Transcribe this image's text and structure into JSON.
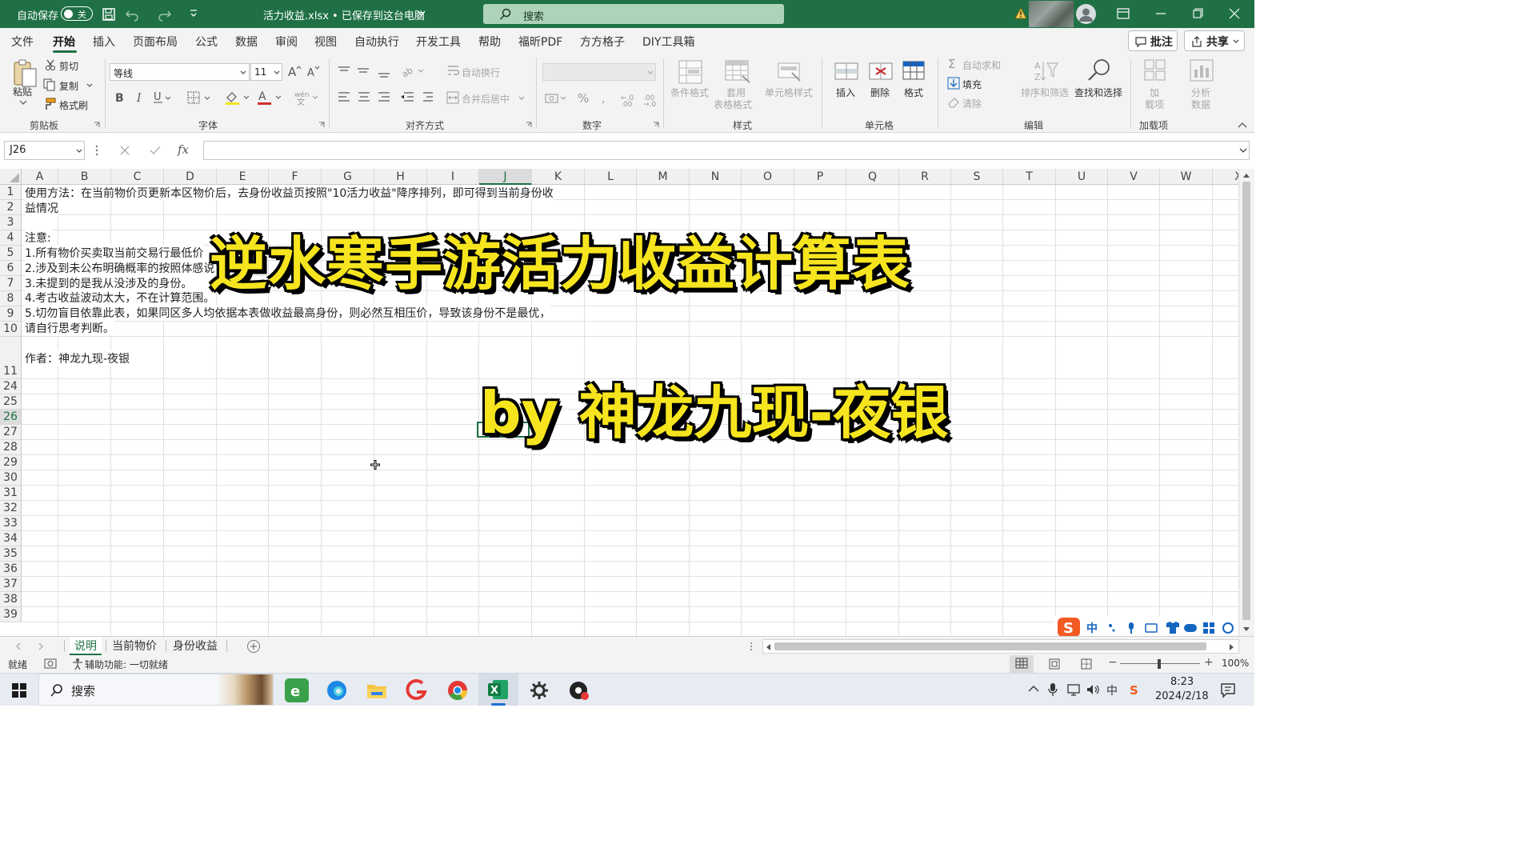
{
  "titlebar": {
    "autosave_label": "自动保存",
    "autosave_state": "关",
    "doc_title": "活力收益.xlsx • 已保存到这台电脑",
    "search_placeholder": "搜索"
  },
  "menu": {
    "tabs": [
      "文件",
      "开始",
      "插入",
      "页面布局",
      "公式",
      "数据",
      "审阅",
      "视图",
      "自动执行",
      "开发工具",
      "帮助",
      "福昕PDF",
      "方方格子",
      "DIY工具箱"
    ],
    "active_tab": "开始",
    "comment_button": "批注",
    "share_button": "共享"
  },
  "ribbon": {
    "clipboard": {
      "paste": "粘贴",
      "cut": "剪切",
      "copy": "复制",
      "format_painter": "格式刷",
      "group": "剪贴板"
    },
    "font": {
      "font_name": "等线",
      "font_size": "11",
      "group": "字体"
    },
    "alignment": {
      "wrap": "自动换行",
      "merge": "合并后居中",
      "group": "对齐方式"
    },
    "number": {
      "group": "数字"
    },
    "styles": {
      "conditional": "条件格式",
      "table_line1": "套用",
      "table_line2": "表格格式",
      "cell_styles": "单元格样式",
      "group": "样式"
    },
    "cells": {
      "insert": "插入",
      "delete": "删除",
      "format": "格式",
      "group": "单元格"
    },
    "editing": {
      "autosum": "自动求和",
      "fill": "填充",
      "clear": "清除",
      "sort": "排序和筛选",
      "find": "查找和选择",
      "group": "编辑"
    },
    "addins": {
      "addin_line1": "加",
      "addin_line2": "载项",
      "analyze_line1": "分析",
      "analyze_line2": "数据",
      "group": "加载项"
    }
  },
  "formula_bar": {
    "name_box": "J26",
    "fx": "fx",
    "content": ""
  },
  "grid": {
    "columns": [
      "A",
      "B",
      "C",
      "D",
      "E",
      "F",
      "G",
      "H",
      "I",
      "J",
      "K",
      "L",
      "M",
      "N",
      "O",
      "P",
      "Q",
      "R",
      "S",
      "T",
      "U",
      "V",
      "W",
      "X"
    ],
    "selected_column": "J",
    "rows": [
      "1",
      "2",
      "3",
      "4",
      "5",
      "6",
      "7",
      "8",
      "9",
      "10",
      "11",
      "24",
      "25",
      "26",
      "27",
      "28",
      "29",
      "30",
      "31",
      "32",
      "33",
      "34",
      "35",
      "36",
      "37",
      "38",
      "39"
    ],
    "selected_row": "26",
    "cells": {
      "a1_line1": "使用方法：在当前物价页更新本区物价后，去身份收益页按照\"10活力收益\"降序排列，即可得到当前身份收",
      "a1_line2": "益情况",
      "a4": "注意:",
      "a5": "1.所有物价买卖取当前交易行最低价",
      "a6": "2.涉及到未公布明确概率的按照体感说",
      "a7": "3.未提到的是我从没涉及的身份。",
      "a8": "4.考古收益波动太大，不在计算范围。",
      "a9_line1": "5.切勿盲目依靠此表，如果同区多人均依据本表做收益最高身份，则必然互相压价，导致该身份不是最优，",
      "a9_line2": "请自行思考判断。",
      "a10": "作者：神龙九现-夜银"
    }
  },
  "overlay": {
    "title": "逆水寒手游活力收益计算表",
    "byline": "by 神龙九现-夜银",
    "color": "#f6e51e"
  },
  "sheets": {
    "tabs": [
      "说明",
      "当前物价",
      "身份收益"
    ],
    "active": "说明"
  },
  "status": {
    "ready": "就绪",
    "accessibility": "辅助功能: 一切就绪",
    "zoom": "100%"
  },
  "ime": {
    "lang": "中"
  },
  "taskbar": {
    "search": "搜索",
    "time": "8:23",
    "date": "2024/2/18",
    "ime": "中"
  },
  "colors": {
    "excel_green": "#1f7145",
    "overlay_yellow": "#f6e51e"
  }
}
